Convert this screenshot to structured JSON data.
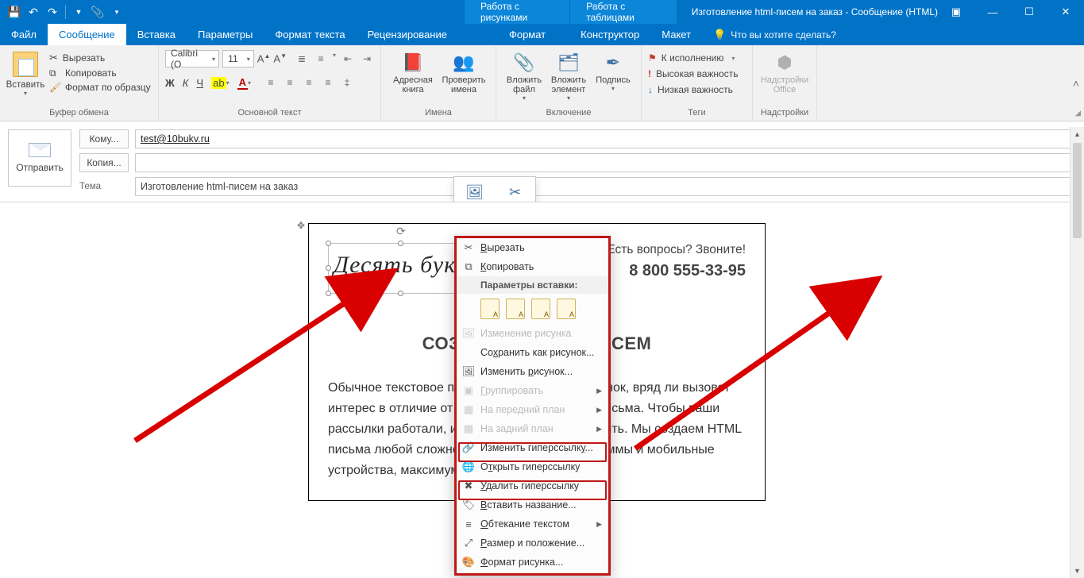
{
  "titlebar": {
    "context_tabs": [
      "Работа с рисунками",
      "Работа с таблицами"
    ],
    "doc_title": "Изготовление html-писем на заказ - Сообщение (HTML)"
  },
  "tabs": {
    "file": "Файл",
    "items": [
      "Сообщение",
      "Вставка",
      "Параметры",
      "Формат текста",
      "Рецензирование",
      "Формат",
      "Конструктор",
      "Макет"
    ],
    "active_index": 0,
    "tell_me": "Что вы хотите сделать?"
  },
  "ribbon": {
    "clipboard": {
      "paste": "Вставить",
      "cut": "Вырезать",
      "copy": "Копировать",
      "format_painter": "Формат по образцу",
      "label": "Буфер обмена"
    },
    "font": {
      "name": "Calibri (О",
      "size": "11",
      "label": "Основной текст"
    },
    "names": {
      "address_book": "Адресная книга",
      "check_names": "Проверить имена",
      "label": "Имена"
    },
    "include": {
      "attach_file": "Вложить файл",
      "attach_item": "Вложить элемент",
      "signature": "Подпись",
      "label": "Включение"
    },
    "tags": {
      "follow_up": "К исполнению",
      "high": "Высокая важность",
      "low": "Низкая важность",
      "label": "Теги"
    },
    "addins": {
      "addins": "Надстройки Office",
      "label": "Надстройки"
    }
  },
  "header": {
    "send": "Отправить",
    "to_btn": "Кому...",
    "cc_btn": "Копия...",
    "subject_lbl": "Тема",
    "to_value": "test@10bukv.ru",
    "subject_value": "Изготовление html-писем на заказ"
  },
  "minitoolbar": {
    "style": "Стиль",
    "crop": "Обрезка"
  },
  "email": {
    "logo": "Десять букв",
    "q": "Есть вопросы? Звоните!",
    "phone": "8 800 555-33-95",
    "h1_left": "СОЗ",
    "h1_right": "ИСЕМ",
    "para": "Обычное текстовое письмо, без красок и картинок, вряд ли вызовет интерес в отличие от красиво оформленного письма. Чтобы ваши рассылки работали, их нужно красиво оформлять. Мы создаем HTML письма любой сложности под почтовые программы и мобильные устройства, максимум, за 3 дня."
  },
  "ctx": {
    "cut": "Вырезать",
    "copy": "Копировать",
    "paste_opts": "Параметры вставки:",
    "change_pic_detail": "Изменение рисунка",
    "save_as_pic": "Сохранить как рисунок...",
    "change_pic": "Изменить рисунок...",
    "group": "Группировать",
    "bring_front": "На передний план",
    "send_back": "На задний план",
    "edit_link": "Изменить гиперссылку...",
    "open_link": "Открыть гиперссылку",
    "remove_link": "Удалить гиперссылку",
    "insert_caption": "Вставить название...",
    "wrap": "Обтекание текстом",
    "size_pos": "Размер и положение...",
    "format_pic": "Формат рисунка..."
  }
}
